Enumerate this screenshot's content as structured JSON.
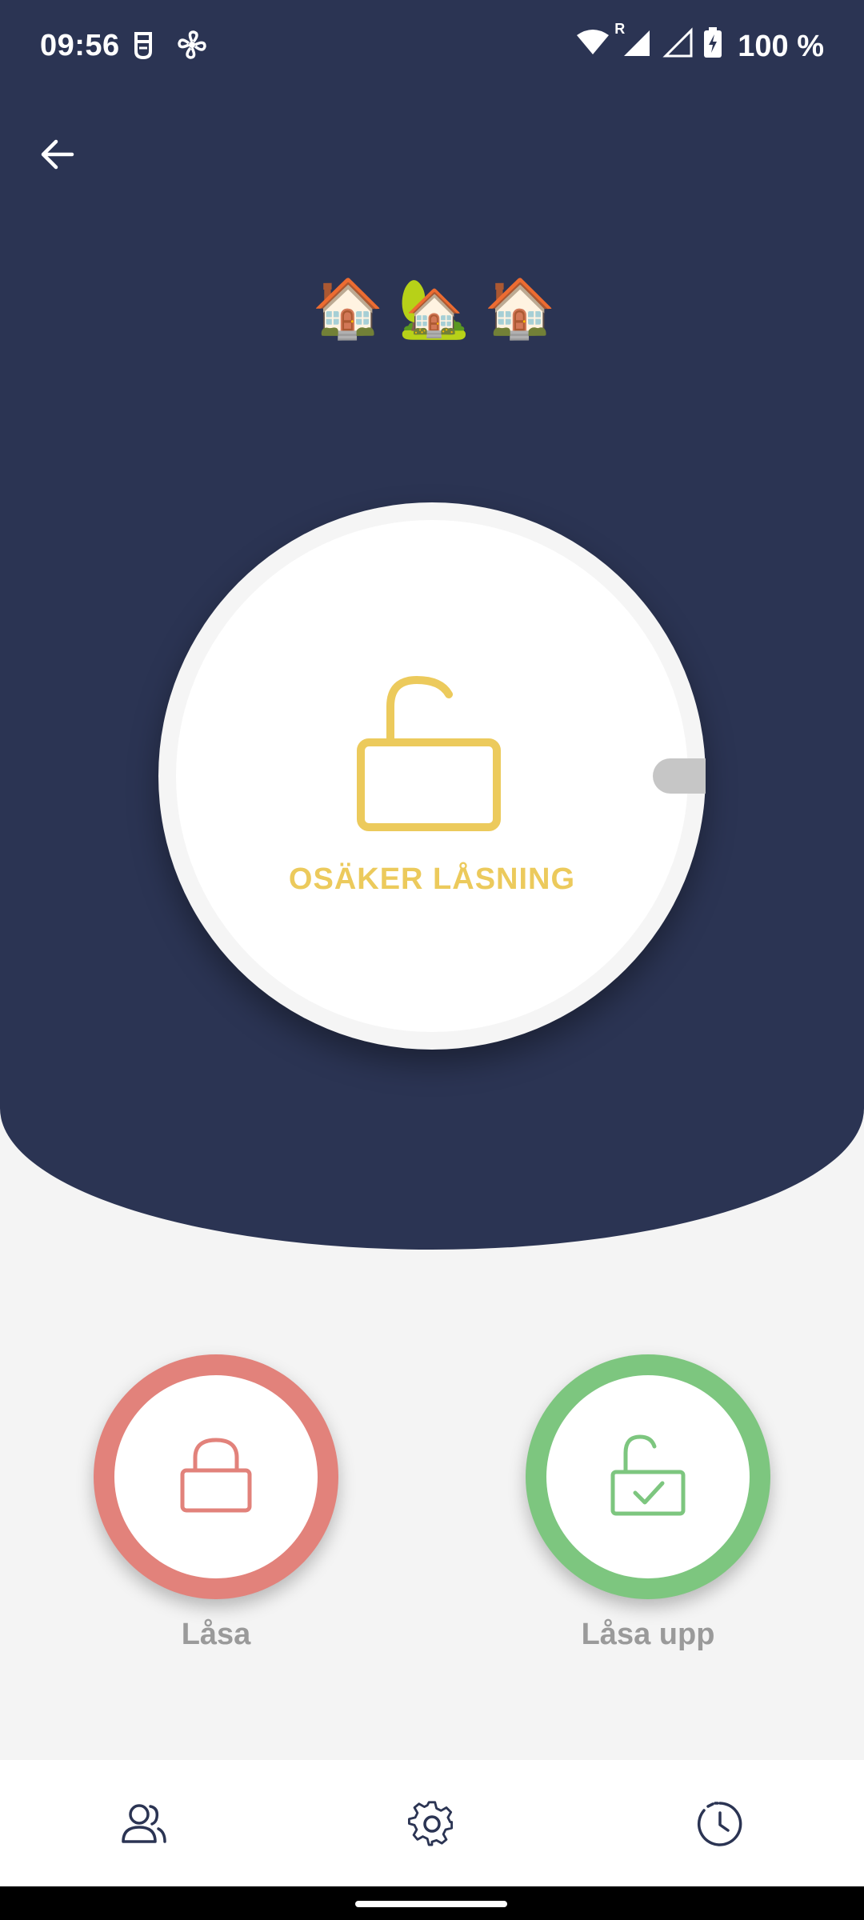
{
  "status_bar": {
    "time": "09:56",
    "left_icons": [
      "face-mask-icon",
      "fan-icon"
    ],
    "right_icons": [
      "wifi-icon",
      "signal-roaming-icon",
      "signal-icon",
      "battery-charging-icon"
    ],
    "roaming_label": "R",
    "battery_text": "100 %"
  },
  "header": {
    "back_icon": "arrow-left-icon",
    "lock_name_emojis": [
      "🏠",
      "🏡",
      "🏠"
    ]
  },
  "dial": {
    "status_text": "OSÄKER LÅSNING",
    "status_color": "#ecca5c",
    "icon": "lock-open-icon"
  },
  "actions": {
    "lock": {
      "label": "Låsa",
      "color": "#e2827b",
      "icon": "lock-closed-icon"
    },
    "unlock": {
      "label": "Låsa upp",
      "color": "#7dc67f",
      "icon": "lock-open-check-icon"
    }
  },
  "bottom_nav": {
    "items": [
      "users-icon",
      "gear-icon",
      "history-clock-icon"
    ]
  },
  "colors": {
    "header_bg": "#2b3453",
    "page_bg": "#f4f4f4"
  }
}
